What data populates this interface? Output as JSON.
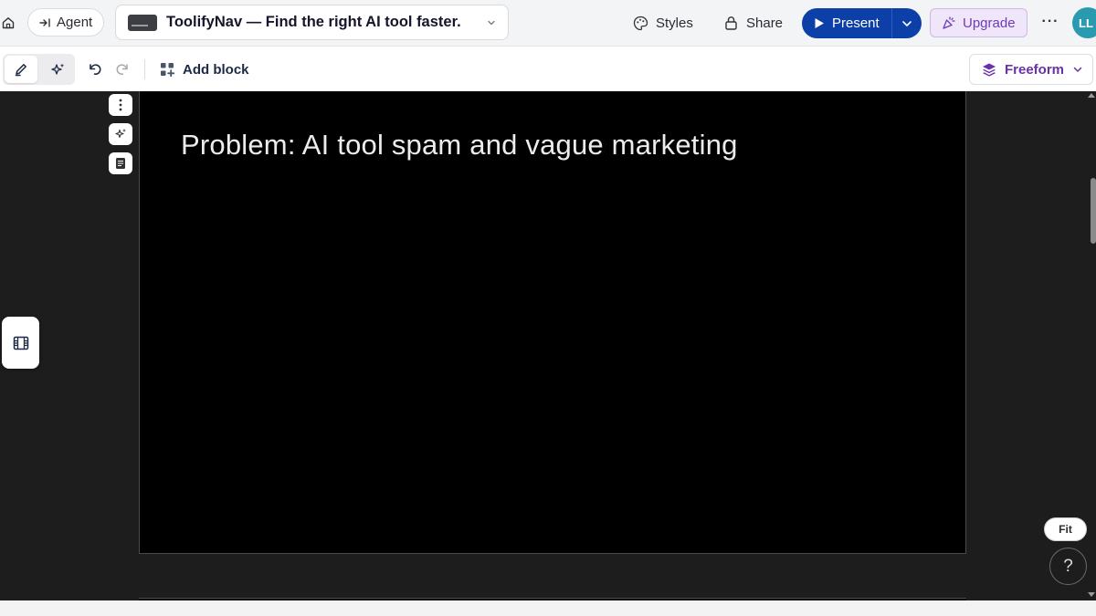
{
  "header": {
    "agent_label": "Agent",
    "doc_title": "ToolifyNav — Find the right AI tool faster.",
    "styles_label": "Styles",
    "share_label": "Share",
    "present_label": "Present",
    "upgrade_label": "Upgrade",
    "more_label": "···",
    "avatar_initials": "LL"
  },
  "toolbar": {
    "add_block_label": "Add block",
    "freeform_label": "Freeform"
  },
  "slide": {
    "title": "Problem: AI tool spam and vague marketing"
  },
  "canvas_controls": {
    "fit_label": "Fit",
    "help_label": "?"
  },
  "colors": {
    "present_bg": "#0d3fa8",
    "upgrade_bg": "#efe6fa",
    "upgrade_text": "#6e3bb4",
    "freeform_text": "#6b2fa8",
    "avatar_bg": "#2a9ab0",
    "canvas_bg": "#1d1d1d",
    "slide_bg": "#000000"
  },
  "icons": {
    "home": "home-icon",
    "agent": "arrow-into-bar-icon",
    "styles": "palette-icon",
    "share": "lock-icon",
    "present": "play-icon",
    "upgrade": "sparkle-party-icon",
    "edit": "pencil-icon",
    "ai": "sparkles-icon",
    "undo": "undo-icon",
    "redo": "redo-icon",
    "add_block": "grid-plus-icon",
    "freeform": "layers-icon",
    "filmstrip": "film-icon"
  }
}
